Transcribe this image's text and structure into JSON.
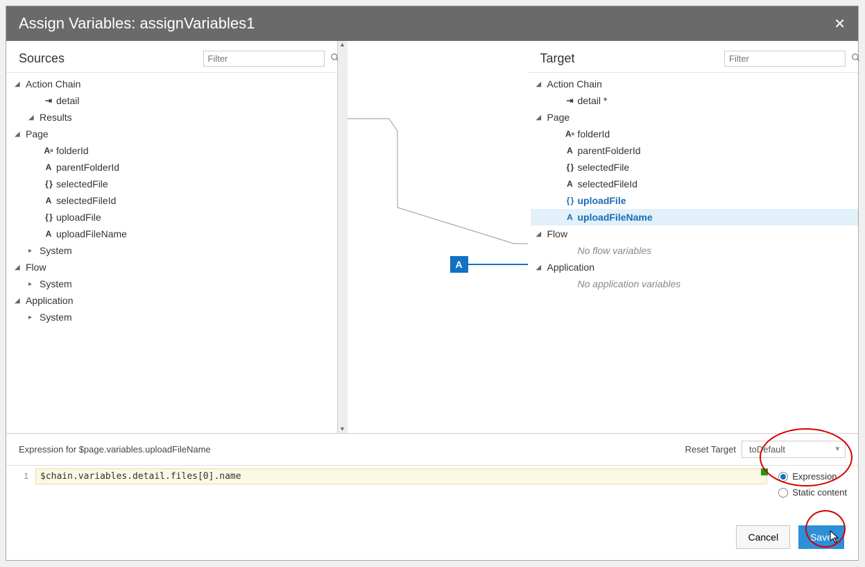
{
  "title": "Assign Variables: assignVariables1",
  "sources": {
    "title": "Sources",
    "filter_placeholder": "Filter",
    "tree": {
      "actionChain": {
        "label": "Action Chain"
      },
      "detail": {
        "label": "detail"
      },
      "results": {
        "label": "Results"
      },
      "page": {
        "label": "Page"
      },
      "folderId": {
        "label": "folderId"
      },
      "parentFolderId": {
        "label": "parentFolderId"
      },
      "selectedFile": {
        "label": "selectedFile"
      },
      "selectedFileId": {
        "label": "selectedFileId"
      },
      "uploadFile": {
        "label": "uploadFile"
      },
      "uploadFileName": {
        "label": "uploadFileName"
      },
      "system1": {
        "label": "System"
      },
      "flow": {
        "label": "Flow"
      },
      "system2": {
        "label": "System"
      },
      "application": {
        "label": "Application"
      },
      "system3": {
        "label": "System"
      }
    }
  },
  "target": {
    "title": "Target",
    "filter_placeholder": "Filter",
    "tree": {
      "actionChain": {
        "label": "Action Chain"
      },
      "detail": {
        "label": "detail *"
      },
      "page": {
        "label": "Page"
      },
      "folderId": {
        "label": "folderId"
      },
      "parentFolderId": {
        "label": "parentFolderId"
      },
      "selectedFile": {
        "label": "selectedFile"
      },
      "selectedFileId": {
        "label": "selectedFileId"
      },
      "uploadFile": {
        "label": "uploadFile"
      },
      "uploadFileName": {
        "label": "uploadFileName"
      },
      "flow": {
        "label": "Flow"
      },
      "noFlow": "No flow variables",
      "application": {
        "label": "Application"
      },
      "noApp": "No application variables"
    }
  },
  "canvas": {
    "badge": "A"
  },
  "expressionBar": {
    "label": "Expression for  $page.variables.uploadFileName",
    "resetLabel": "Reset Target",
    "resetValue": "toDefault"
  },
  "editor": {
    "lineNo": "1",
    "code": "$chain.variables.detail.files[0].name",
    "modeExpression": "Expression",
    "modeStatic": "Static content"
  },
  "actions": {
    "cancel": "Cancel",
    "save": "Save"
  }
}
